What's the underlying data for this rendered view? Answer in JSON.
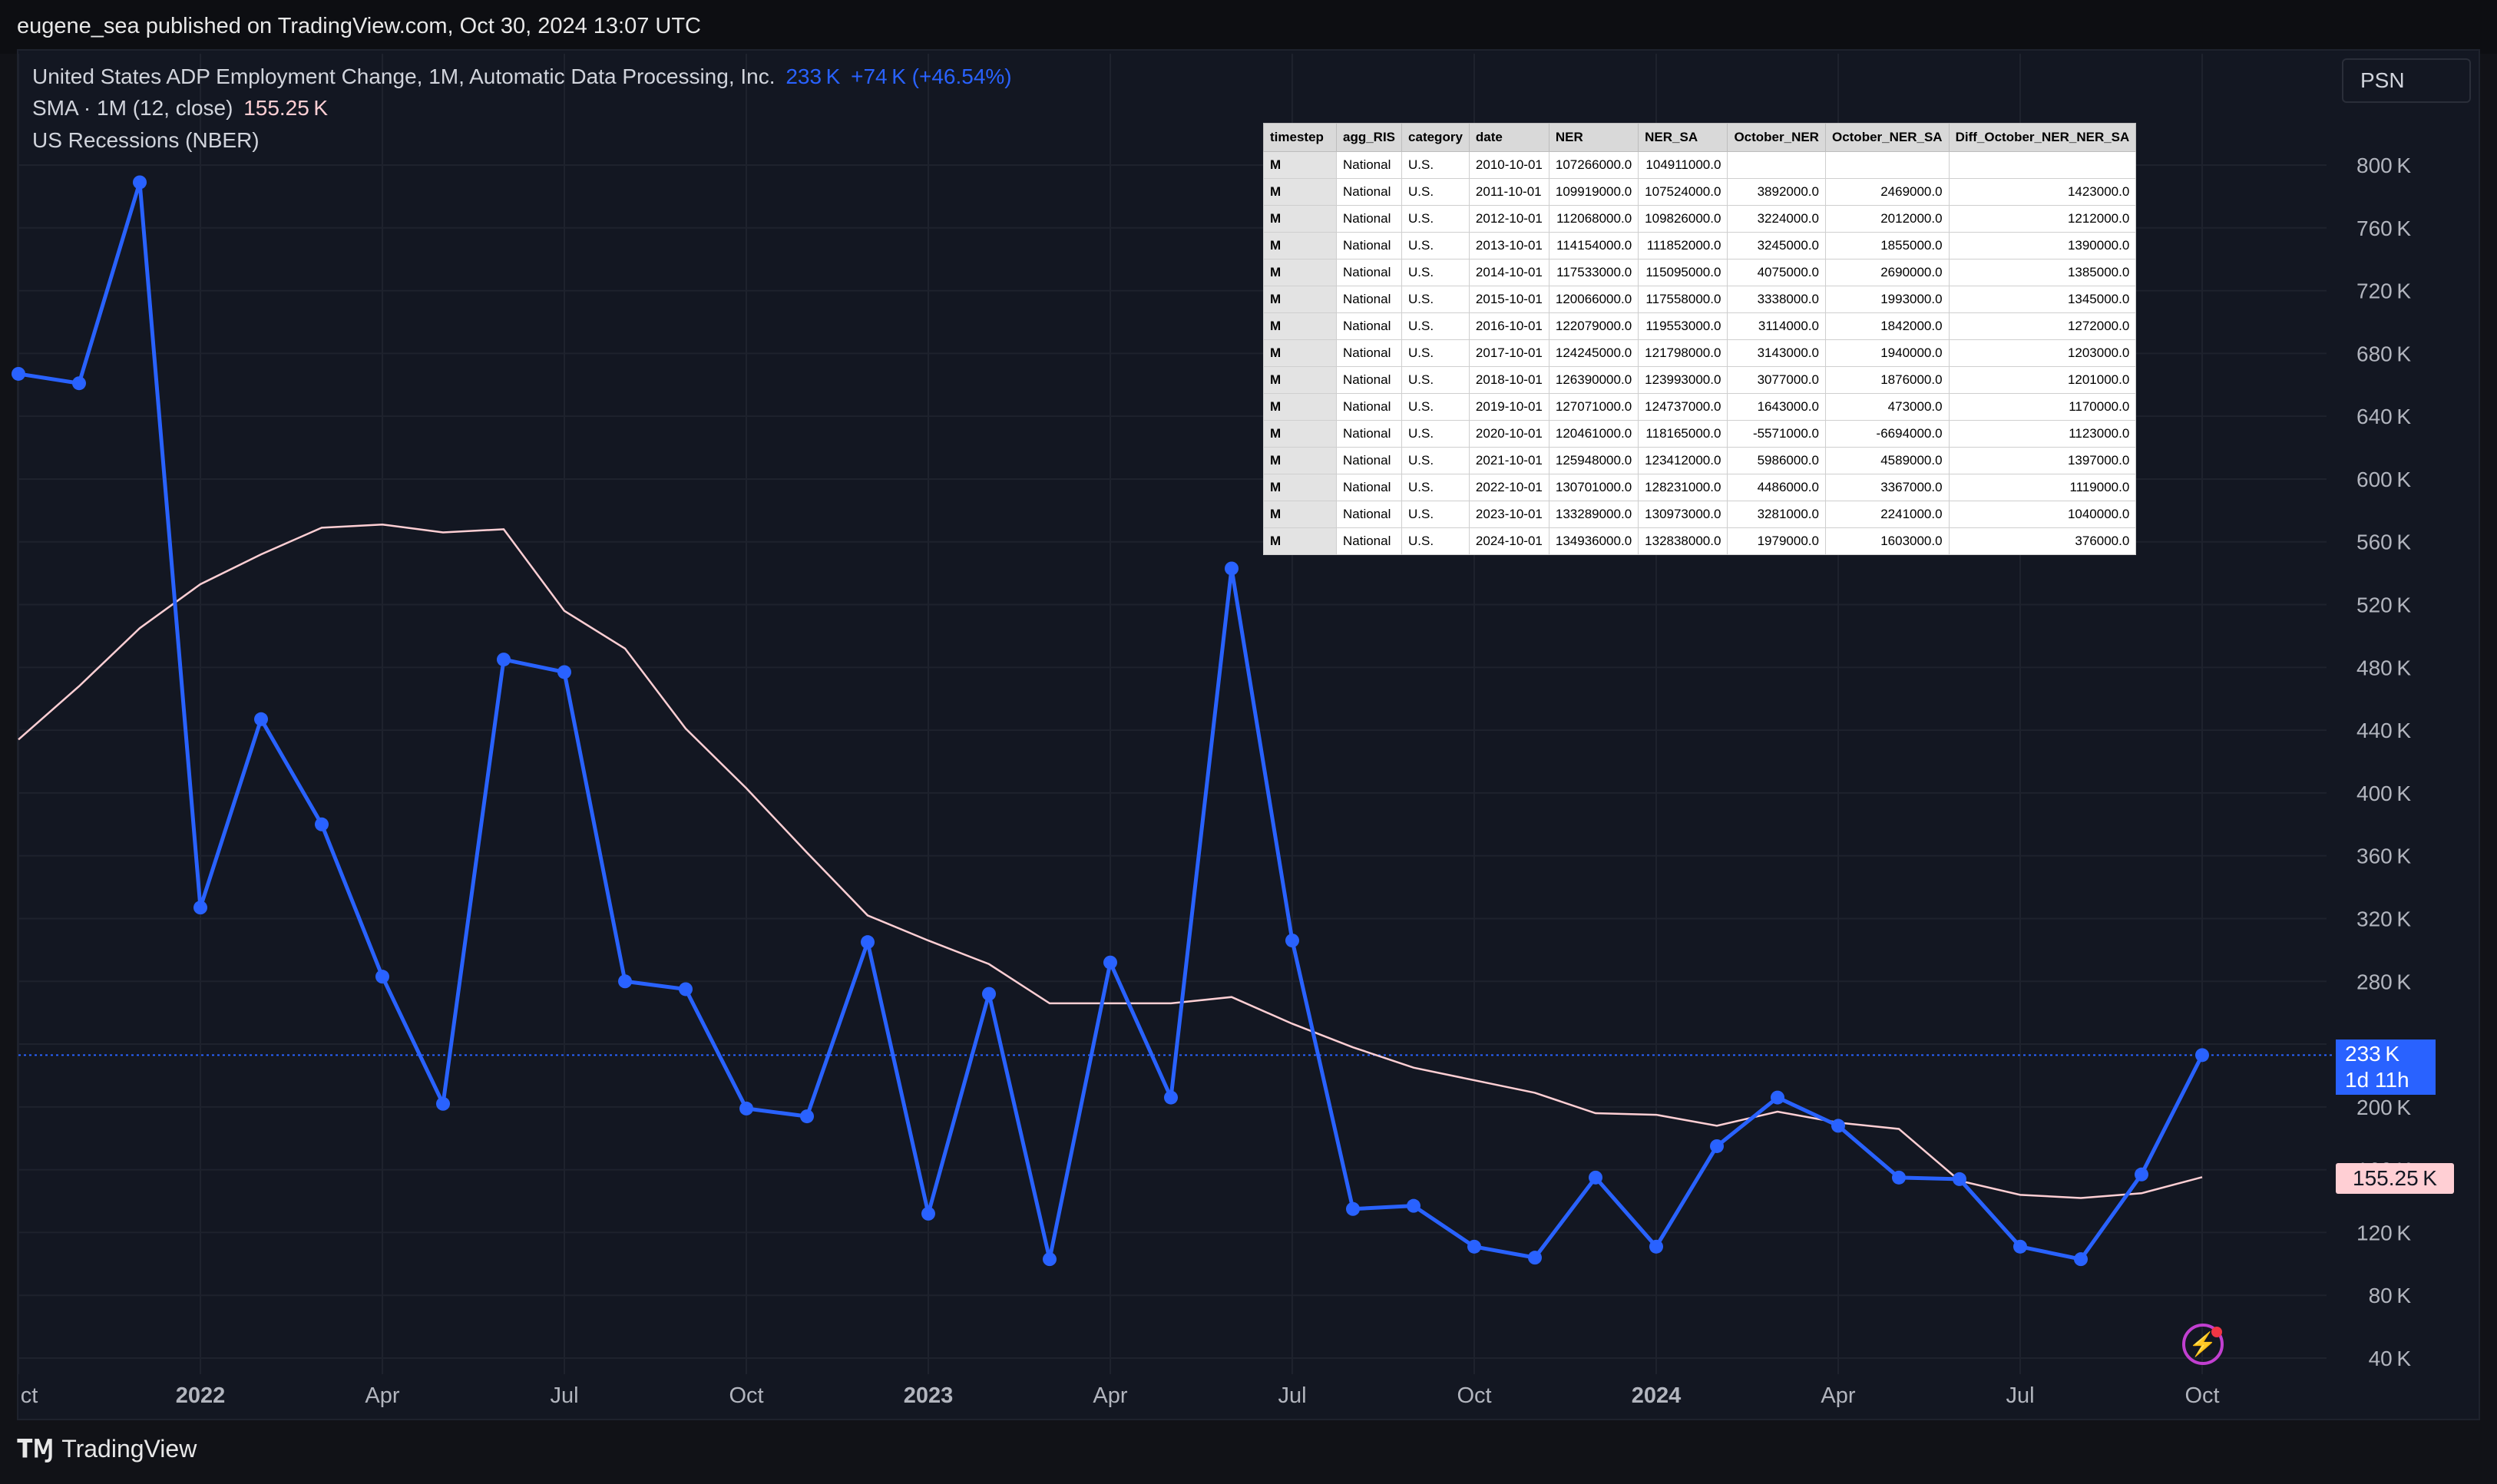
{
  "publisher_line": "eugene_sea published on TradingView.com, Oct 30, 2024 13:07 UTC",
  "legend": {
    "title": "United States ADP Employment Change, 1M, Automatic Data Processing, Inc.",
    "last_value": "233 K",
    "change": "+74 K (+46.54%)",
    "sma_label": "SMA · 1M (12, close)",
    "sma_value": "155.25 K",
    "recessions_label": "US Recessions (NBER)"
  },
  "symbol_box": "PSN",
  "price_tag": {
    "value": "233 K",
    "countdown": "1d 11h"
  },
  "sma_tag": "155.25 K",
  "footer": {
    "brand": "TradingView"
  },
  "colors": {
    "main_line": "#2962ff",
    "sma_line": "#ffcfd4",
    "background": "#131722",
    "grid": "#1e222d",
    "axis_text": "#b2b5be"
  },
  "chart_data": {
    "type": "line",
    "x_tick_labels": [
      "ct",
      "2022",
      "Apr",
      "Jul",
      "Oct",
      "2023",
      "Apr",
      "Jul",
      "Oct",
      "2024",
      "Apr",
      "Jul",
      "Oct"
    ],
    "y_tick_labels": [
      "40 K",
      "80 K",
      "120 K",
      "160 K",
      "200 K",
      "240 K",
      "280 K",
      "320 K",
      "360 K",
      "400 K",
      "440 K",
      "480 K",
      "520 K",
      "560 K",
      "600 K",
      "640 K",
      "680 K",
      "720 K",
      "760 K",
      "800 K"
    ],
    "ylim": [
      40,
      800
    ],
    "y_unit": "K",
    "x": [
      "2021-10",
      "2021-11",
      "2021-12",
      "2022-01",
      "2022-02",
      "2022-03",
      "2022-04",
      "2022-05",
      "2022-06",
      "2022-07",
      "2022-08",
      "2022-09",
      "2022-10",
      "2022-11",
      "2022-12",
      "2023-01",
      "2023-02",
      "2023-03",
      "2023-04",
      "2023-05",
      "2023-06",
      "2023-07",
      "2023-08",
      "2023-09",
      "2023-10",
      "2023-11",
      "2023-12",
      "2024-01",
      "2024-02",
      "2024-03",
      "2024-04",
      "2024-05",
      "2024-06",
      "2024-07",
      "2024-08",
      "2024-09",
      "2024-10"
    ],
    "series": [
      {
        "name": "United States ADP Employment Change",
        "values": [
          667,
          661,
          789,
          327,
          447,
          380,
          283,
          202,
          485,
          477,
          280,
          275,
          199,
          194,
          305,
          132,
          272,
          103,
          292,
          206,
          543,
          306,
          135,
          137,
          111,
          104,
          155,
          111,
          175,
          206,
          188,
          155,
          154,
          111,
          103,
          157,
          233
        ]
      },
      {
        "name": "SMA · 1M (12, close)",
        "values": [
          434,
          468,
          505,
          533,
          552,
          569,
          571,
          566,
          568,
          516,
          492,
          441,
          403,
          362,
          322,
          306,
          291,
          266,
          266,
          266,
          270,
          253,
          238,
          225,
          217,
          209,
          196,
          195,
          188,
          197,
          190,
          186,
          153,
          144,
          142,
          145,
          155.25
        ]
      }
    ]
  },
  "table": {
    "columns": [
      "timestep",
      "agg_RIS",
      "category",
      "date",
      "NER",
      "NER_SA",
      "October_NER",
      "October_NER_SA",
      "Diff_October_NER_NER_SA"
    ],
    "rows": [
      [
        "M",
        "National",
        "U.S.",
        "2010-10-01",
        "107266000.0",
        "104911000.0",
        "",
        "",
        ""
      ],
      [
        "M",
        "National",
        "U.S.",
        "2011-10-01",
        "109919000.0",
        "107524000.0",
        "3892000.0",
        "2469000.0",
        "1423000.0"
      ],
      [
        "M",
        "National",
        "U.S.",
        "2012-10-01",
        "112068000.0",
        "109826000.0",
        "3224000.0",
        "2012000.0",
        "1212000.0"
      ],
      [
        "M",
        "National",
        "U.S.",
        "2013-10-01",
        "114154000.0",
        "111852000.0",
        "3245000.0",
        "1855000.0",
        "1390000.0"
      ],
      [
        "M",
        "National",
        "U.S.",
        "2014-10-01",
        "117533000.0",
        "115095000.0",
        "4075000.0",
        "2690000.0",
        "1385000.0"
      ],
      [
        "M",
        "National",
        "U.S.",
        "2015-10-01",
        "120066000.0",
        "117558000.0",
        "3338000.0",
        "1993000.0",
        "1345000.0"
      ],
      [
        "M",
        "National",
        "U.S.",
        "2016-10-01",
        "122079000.0",
        "119553000.0",
        "3114000.0",
        "1842000.0",
        "1272000.0"
      ],
      [
        "M",
        "National",
        "U.S.",
        "2017-10-01",
        "124245000.0",
        "121798000.0",
        "3143000.0",
        "1940000.0",
        "1203000.0"
      ],
      [
        "M",
        "National",
        "U.S.",
        "2018-10-01",
        "126390000.0",
        "123993000.0",
        "3077000.0",
        "1876000.0",
        "1201000.0"
      ],
      [
        "M",
        "National",
        "U.S.",
        "2019-10-01",
        "127071000.0",
        "124737000.0",
        "1643000.0",
        "473000.0",
        "1170000.0"
      ],
      [
        "M",
        "National",
        "U.S.",
        "2020-10-01",
        "120461000.0",
        "118165000.0",
        "-5571000.0",
        "-6694000.0",
        "1123000.0"
      ],
      [
        "M",
        "National",
        "U.S.",
        "2021-10-01",
        "125948000.0",
        "123412000.0",
        "5986000.0",
        "4589000.0",
        "1397000.0"
      ],
      [
        "M",
        "National",
        "U.S.",
        "2022-10-01",
        "130701000.0",
        "128231000.0",
        "4486000.0",
        "3367000.0",
        "1119000.0"
      ],
      [
        "M",
        "National",
        "U.S.",
        "2023-10-01",
        "133289000.0",
        "130973000.0",
        "3281000.0",
        "2241000.0",
        "1040000.0"
      ],
      [
        "M",
        "National",
        "U.S.",
        "2024-10-01",
        "134936000.0",
        "132838000.0",
        "1979000.0",
        "1603000.0",
        "376000.0"
      ]
    ]
  }
}
